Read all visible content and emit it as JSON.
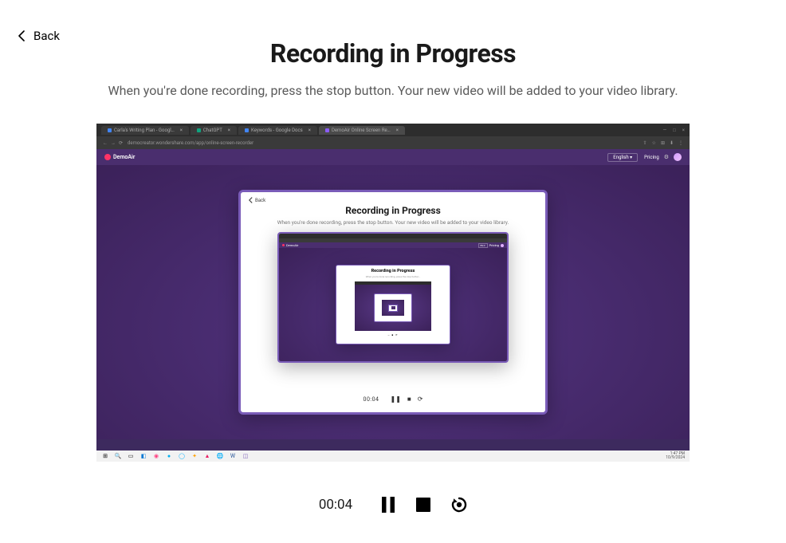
{
  "back_label": "Back",
  "title": "Recording in Progress",
  "subtitle": "When you're done recording, press the stop button. Your new video will be added to your video library.",
  "browser": {
    "tabs": [
      {
        "label": "Carla's Writing Plan - Googl…",
        "fav": "#4285f4"
      },
      {
        "label": "ChatGPT",
        "fav": "#10a37f"
      },
      {
        "label": "Keywords - Google Docs",
        "fav": "#4285f4"
      },
      {
        "label": "DemoAir Online Screen Re…",
        "fav": "#8b5cf6",
        "active": true
      }
    ],
    "url": "democreator.wondershare.com/app/online-screen-recorder"
  },
  "app": {
    "name": "DemoAir",
    "language": "English",
    "pricing": "Pricing"
  },
  "inner": {
    "back": "Back",
    "title": "Recording in Progress",
    "subtitle": "When you're done recording, press the stop button. Your new video will be added to your video library.",
    "time": "00:04",
    "nested_title": "Recording in Progress"
  },
  "player": {
    "time": "00:04"
  },
  "sys": {
    "time": "1:47 PM",
    "date": "10/9/2024"
  }
}
